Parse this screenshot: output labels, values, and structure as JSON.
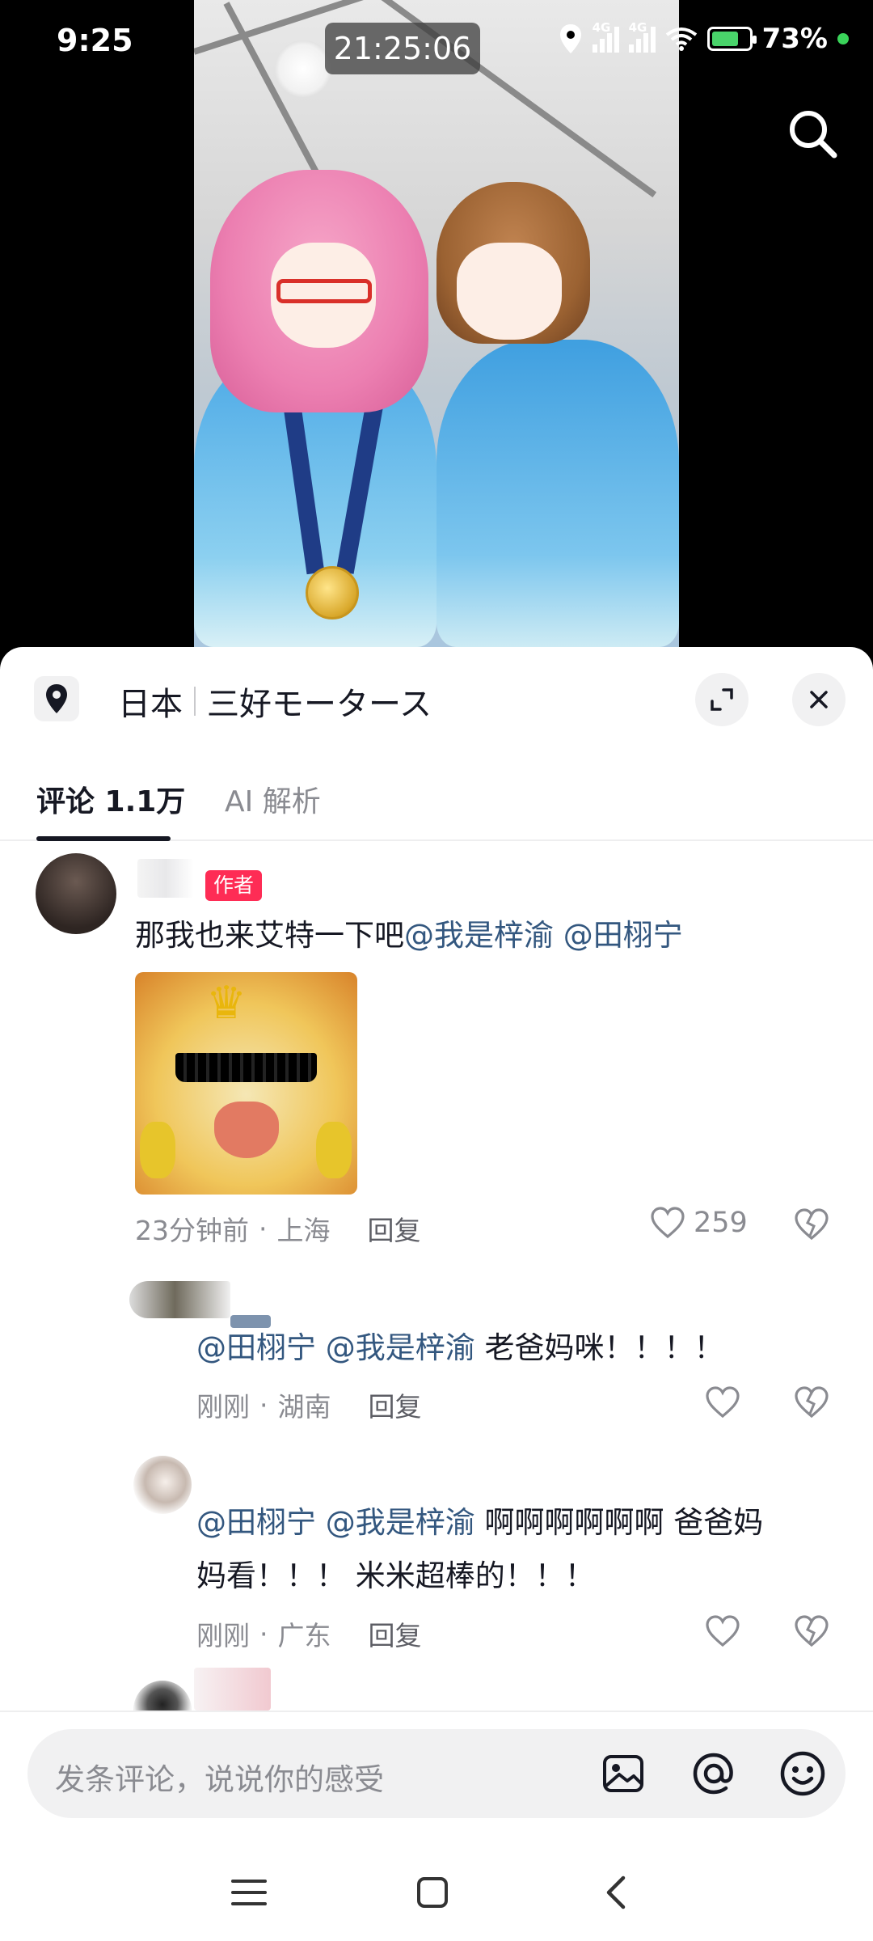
{
  "status_bar": {
    "time": "9:25",
    "recording_time": "21:25:06",
    "network_1": "4G",
    "network_2": "4G",
    "battery": "73%",
    "battery_level": 0.73
  },
  "video": {
    "search_icon": "search-icon"
  },
  "sheet": {
    "location_country": "日本",
    "location_place": "三好モータース",
    "expand_icon": "expand-icon",
    "close_icon": "close-icon"
  },
  "tabs": {
    "comments": "评论 1.1万",
    "ai": "AI 解析"
  },
  "comments": [
    {
      "author_tag": "作者",
      "text_plain": "那我也来艾特一下吧",
      "mention_1": "@我是梓渝",
      "mention_2": "@田栩宁",
      "time": "23分钟前",
      "region": "上海",
      "reply": "回复",
      "likes": "259"
    },
    {
      "mention_1": "@田栩宁",
      "mention_2": "@我是梓渝",
      "text_plain": "老爸妈咪！！！！",
      "time": "刚刚",
      "region": "湖南",
      "reply": "回复"
    },
    {
      "mention_1": "@田栩宁",
      "mention_2": "@我是梓渝",
      "text_plain_1": "啊啊啊啊啊啊 爸爸妈",
      "text_plain_2": "妈看！！！ 米米超棒的！！！",
      "time": "刚刚",
      "region": "广东",
      "reply": "回复"
    }
  ],
  "meta_separator": "·",
  "input": {
    "placeholder": "发条评论，说说你的感受",
    "icons": [
      "image-icon",
      "at-icon",
      "emoji-icon"
    ]
  },
  "navbar": {
    "icons": [
      "menu-icon",
      "home-icon",
      "back-icon"
    ]
  },
  "colors": {
    "accent": "#fe2c55",
    "mention": "#33577f",
    "muted": "#8a8b91"
  }
}
